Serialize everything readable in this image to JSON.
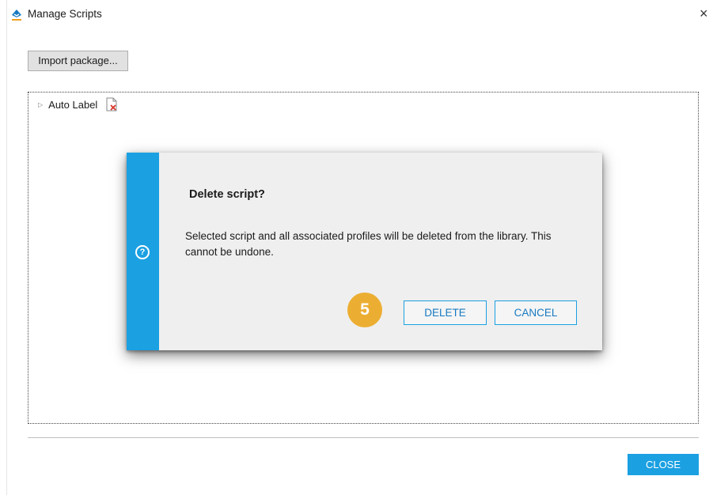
{
  "window": {
    "title": "Manage Scripts",
    "close_glyph": "×"
  },
  "toolbar": {
    "import_label": "Import package..."
  },
  "tree": {
    "items": [
      {
        "label": "Auto Label",
        "expander": "▷",
        "icon": "script-error-icon"
      }
    ]
  },
  "footer": {
    "close_label": "CLOSE"
  },
  "dialog": {
    "title": "Delete script?",
    "message": "Selected script and all associated profiles will be deleted from the library. This cannot be undone.",
    "help_glyph": "?",
    "delete_label": "DELETE",
    "cancel_label": "CANCEL",
    "step_badge": "5"
  },
  "colors": {
    "accent": "#1ba0e2",
    "badge": "#ecae32",
    "dialog_bg": "#efefef"
  }
}
